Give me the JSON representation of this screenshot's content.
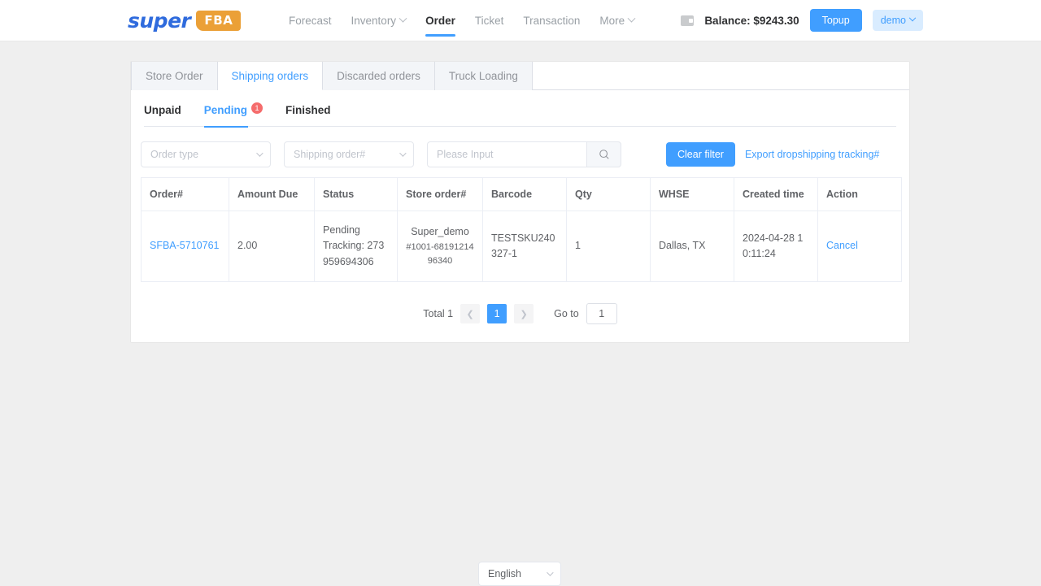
{
  "header": {
    "logo_word": "super",
    "logo_badge": "FBA",
    "nav": [
      {
        "label": "Forecast",
        "has_caret": false,
        "active": false
      },
      {
        "label": "Inventory",
        "has_caret": true,
        "active": false
      },
      {
        "label": "Order",
        "has_caret": false,
        "active": true
      },
      {
        "label": "Ticket",
        "has_caret": false,
        "active": false
      },
      {
        "label": "Transaction",
        "has_caret": false,
        "active": false
      },
      {
        "label": "More",
        "has_caret": true,
        "active": false
      }
    ],
    "wallet_icon": "wallet-icon",
    "balance": "Balance: $9243.30",
    "topup_label": "Topup",
    "account_label": "demo",
    "accent_color": "#409eff",
    "brand_orange": "#eba037",
    "brand_blue": "#2f6bdd"
  },
  "tabs": [
    {
      "label": "Store Order",
      "active": false
    },
    {
      "label": "Shipping orders",
      "active": true
    },
    {
      "label": "Discarded orders",
      "active": false
    },
    {
      "label": "Truck Loading",
      "active": false
    }
  ],
  "subtabs": [
    {
      "label": "Unpaid",
      "active": false,
      "badge": null
    },
    {
      "label": "Pending",
      "active": true,
      "badge": "1"
    },
    {
      "label": "Finished",
      "active": false,
      "badge": null
    }
  ],
  "filters": {
    "order_type_placeholder": "Order type",
    "shipping_order_placeholder": "Shipping order#",
    "search_placeholder": "Please Input",
    "search_value": "",
    "search_icon": "search-icon",
    "clear_filter_label": "Clear filter",
    "export_link_label": "Export dropshipping tracking#"
  },
  "table": {
    "columns": [
      "Order#",
      "Amount Due",
      "Status",
      "Store order#",
      "Barcode",
      "Qty",
      "WHSE",
      "Created time",
      "Action"
    ],
    "rows": [
      {
        "order_no": "SFBA-5710761",
        "amount_due": "2.00",
        "status": "Pending",
        "tracking": "Tracking: 273959694306",
        "store_name": "Super_demo",
        "store_order_no": "#1001-6819121496340",
        "barcode": "TESTSKU240327-1",
        "qty": "1",
        "whse": "Dallas, TX",
        "created_time": "2024-04-28 10:11:24",
        "action": "Cancel"
      }
    ]
  },
  "pagination": {
    "total_label": "Total 1",
    "prev_icon": "chevron-left-icon",
    "next_icon": "chevron-right-icon",
    "current_page": "1",
    "goto_label": "Go to",
    "goto_value": "1"
  },
  "language": {
    "value": "English",
    "caret_icon": "chevron-down-icon"
  }
}
